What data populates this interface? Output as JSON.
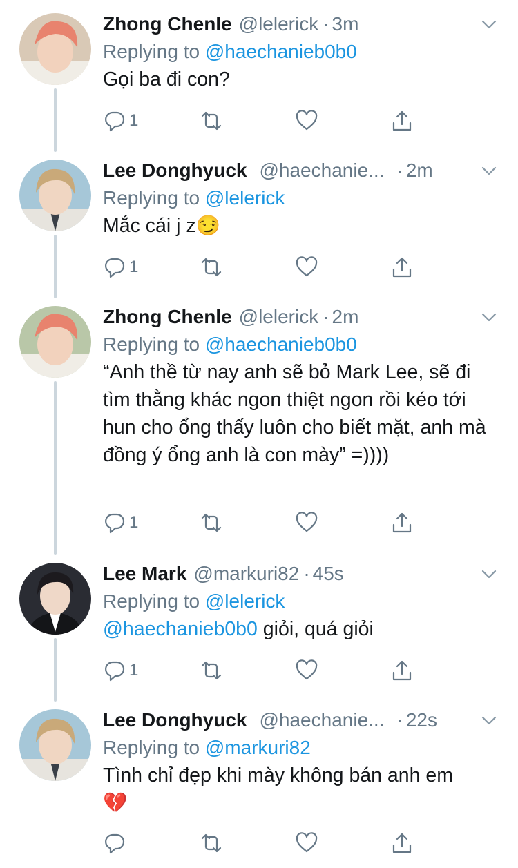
{
  "tweets": [
    {
      "name": "Zhong Chenle",
      "handle": "@lelerick",
      "dot": "·",
      "time": "3m",
      "replying_prefix": "Replying to",
      "replying_to": "@haechanieb0b0",
      "text": "Gọi ba đi con?",
      "mention": "",
      "emoji": "",
      "reply_count": "1",
      "avatar_hair": "#e8836e"
    },
    {
      "name": "Lee Donghyuck",
      "handle": "@haechanie...",
      "dot": "·",
      "time": "2m",
      "replying_prefix": "Replying to",
      "replying_to": "@lelerick",
      "text": "Mắc cái j z",
      "mention": "",
      "emoji": "😏",
      "reply_count": "1",
      "avatar_hair": "#c9a979"
    },
    {
      "name": "Zhong Chenle",
      "handle": "@lelerick",
      "dot": "·",
      "time": "2m",
      "replying_prefix": "Replying to",
      "replying_to": "@haechanieb0b0",
      "text": "“Anh thề từ nay anh sẽ bỏ Mark Lee, sẽ đi tìm thằng khác ngon thiệt ngon rồi kéo tới hun cho ổng thấy luôn cho biết mặt, anh mà đồng ý ổng anh là con mày” =))))",
      "mention": "",
      "emoji": "",
      "reply_count": "1",
      "avatar_hair": "#e8836e"
    },
    {
      "name": "Lee Mark",
      "handle": "@markuri82",
      "dot": "·",
      "time": "45s",
      "replying_prefix": "Replying to",
      "replying_to": "@lelerick",
      "text": " giỏi, quá giỏi",
      "mention": "@haechanieb0b0",
      "emoji": "",
      "reply_count": "1",
      "avatar_hair": "#1c1a1e"
    },
    {
      "name": "Lee Donghyuck",
      "handle": "@haechanie...",
      "dot": "·",
      "time": "22s",
      "replying_prefix": "Replying to",
      "replying_to": "@markuri82",
      "text": "Tình chỉ đẹp khi mày không bán anh em",
      "mention": "",
      "emoji": "💔",
      "reply_count": "",
      "avatar_hair": "#c9a979"
    }
  ],
  "icons": {
    "reply": "reply-icon",
    "retweet": "retweet-icon",
    "like": "heart-icon",
    "share": "share-icon",
    "caret": "chevron-down-icon"
  },
  "colors": {
    "text": "#14171a",
    "muted": "#657786",
    "link": "#1b95e0",
    "thread": "#ccd6dd",
    "icon": "#657786"
  }
}
